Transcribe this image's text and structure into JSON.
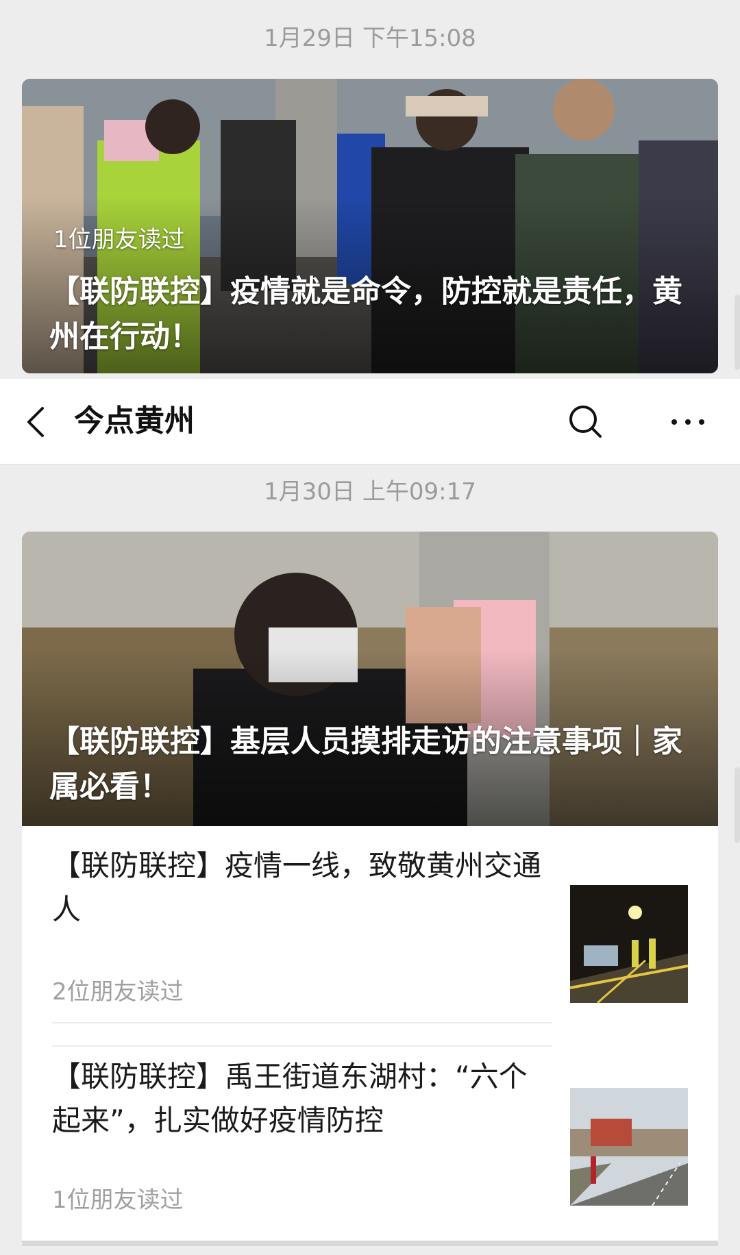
{
  "messages": [
    {
      "timestamp": "1月29日 下午15:08",
      "read_by": "1位朋友读过",
      "title": "【联防联控】疫情就是命令，防控就是责任，黄州在行动！"
    },
    {
      "timestamp": "1月30日 上午09:17",
      "title": "【联防联控】基层人员摸排走访的注意事项｜家属必看！"
    }
  ],
  "navbar": {
    "title": "今点黄州",
    "back_icon": "chevron-left-icon",
    "search_icon": "search-icon",
    "more_icon": "more-dots-icon"
  },
  "articles": [
    {
      "title": "【联防联控】疫情一线，致敬黄州交通人",
      "read_by": "2位朋友读过",
      "thumbnail": "night-traffic-photo"
    },
    {
      "title": "【联防联控】禹王街道东湖村：“六个起来”，扎实做好疫情防控",
      "read_by": "1位朋友读过",
      "thumbnail": "village-road-photo"
    }
  ]
}
